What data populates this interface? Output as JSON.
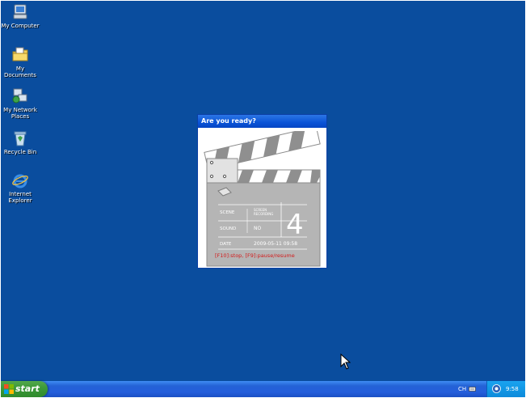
{
  "desktop": {
    "icons": [
      {
        "label": "My Computer"
      },
      {
        "label": "My Documents"
      },
      {
        "label": "My Network Places"
      },
      {
        "label": "Recycle Bin"
      },
      {
        "label": "Internet Explorer"
      }
    ]
  },
  "dialog": {
    "title": "Are you ready?",
    "slate": {
      "scene_label": "SCENE",
      "scene_value_line1": "SCREEN",
      "scene_value_line2": "RECORDING",
      "sound_label": "SOUND",
      "sound_value": "NO",
      "date_label": "DATE",
      "date_value": "2009-05-11 09:58",
      "countdown": "4"
    },
    "hotkeys": "[F10]:stop, [F9]:pause/resume"
  },
  "taskbar": {
    "start_label": "start",
    "language": "CH",
    "clock": "9:58"
  },
  "colors": {
    "desktop": "#0a4d9e",
    "titlebar": "#0a53d6",
    "start_green": "#3d9a3a",
    "hotkey_red": "#d41a1a",
    "slate_gray": "#b5b5b5"
  }
}
